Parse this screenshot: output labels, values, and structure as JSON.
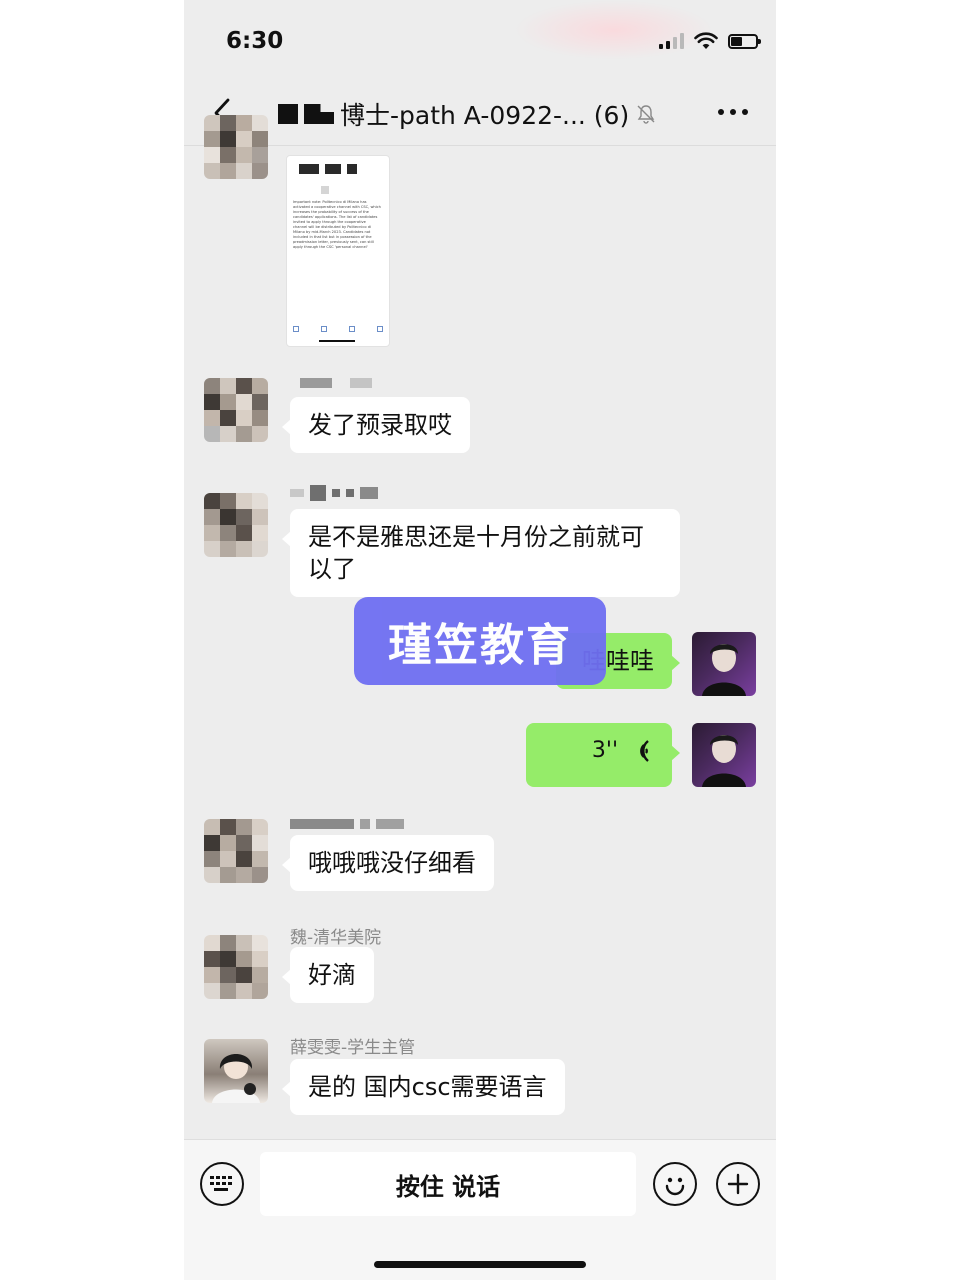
{
  "status_bar": {
    "time": "6:30",
    "battery_level": 0.45
  },
  "nav": {
    "title": "博士-path A-0922-... (6)",
    "back_icon": "chevron-left-icon",
    "mute_icon": "bell-slash-icon",
    "more_icon": "ellipsis-icon"
  },
  "messages": [
    {
      "type": "image",
      "side": "left",
      "sender": "",
      "doc_excerpt": "Important note: Politecnico di Milano has activated a cooperative channel with CSC, which increases the probability of success of the candidates' applications. The list of candidates invited to apply through the cooperative channel will be distributed by Politecnico di Milano by mid-March 2023. Candidates not included in that list but in possession of the preadmission letter, previously sent, can still apply through the CSC 'personal channel'"
    },
    {
      "type": "text",
      "side": "left",
      "sender": "",
      "text": "发了预录取哎"
    },
    {
      "type": "text",
      "side": "left",
      "sender": "",
      "text": "是不是雅思还是十月份之前就可以了"
    },
    {
      "type": "text",
      "side": "right",
      "text": "哇哇哇"
    },
    {
      "type": "voice",
      "side": "right",
      "duration": "3''"
    },
    {
      "type": "text",
      "side": "left",
      "sender": "",
      "text": "哦哦哦没仔细看"
    },
    {
      "type": "text",
      "side": "left",
      "sender": "魏-清华美院",
      "text": "好滴"
    },
    {
      "type": "text",
      "side": "left",
      "sender": "薛雯雯-学生主管",
      "text": "是的 国内csc需要语言"
    }
  ],
  "watermark": "瑾笠教育",
  "input_bar": {
    "hold_to_talk": "按住 说话",
    "keyboard_icon": "keyboard-icon",
    "emoji_icon": "emoji-icon",
    "plus_icon": "plus-icon"
  },
  "colors": {
    "chat_bg": "#ededed",
    "bubble_self": "#95ec69",
    "bubble_other": "#ffffff",
    "watermark": "#6f6ff2"
  }
}
